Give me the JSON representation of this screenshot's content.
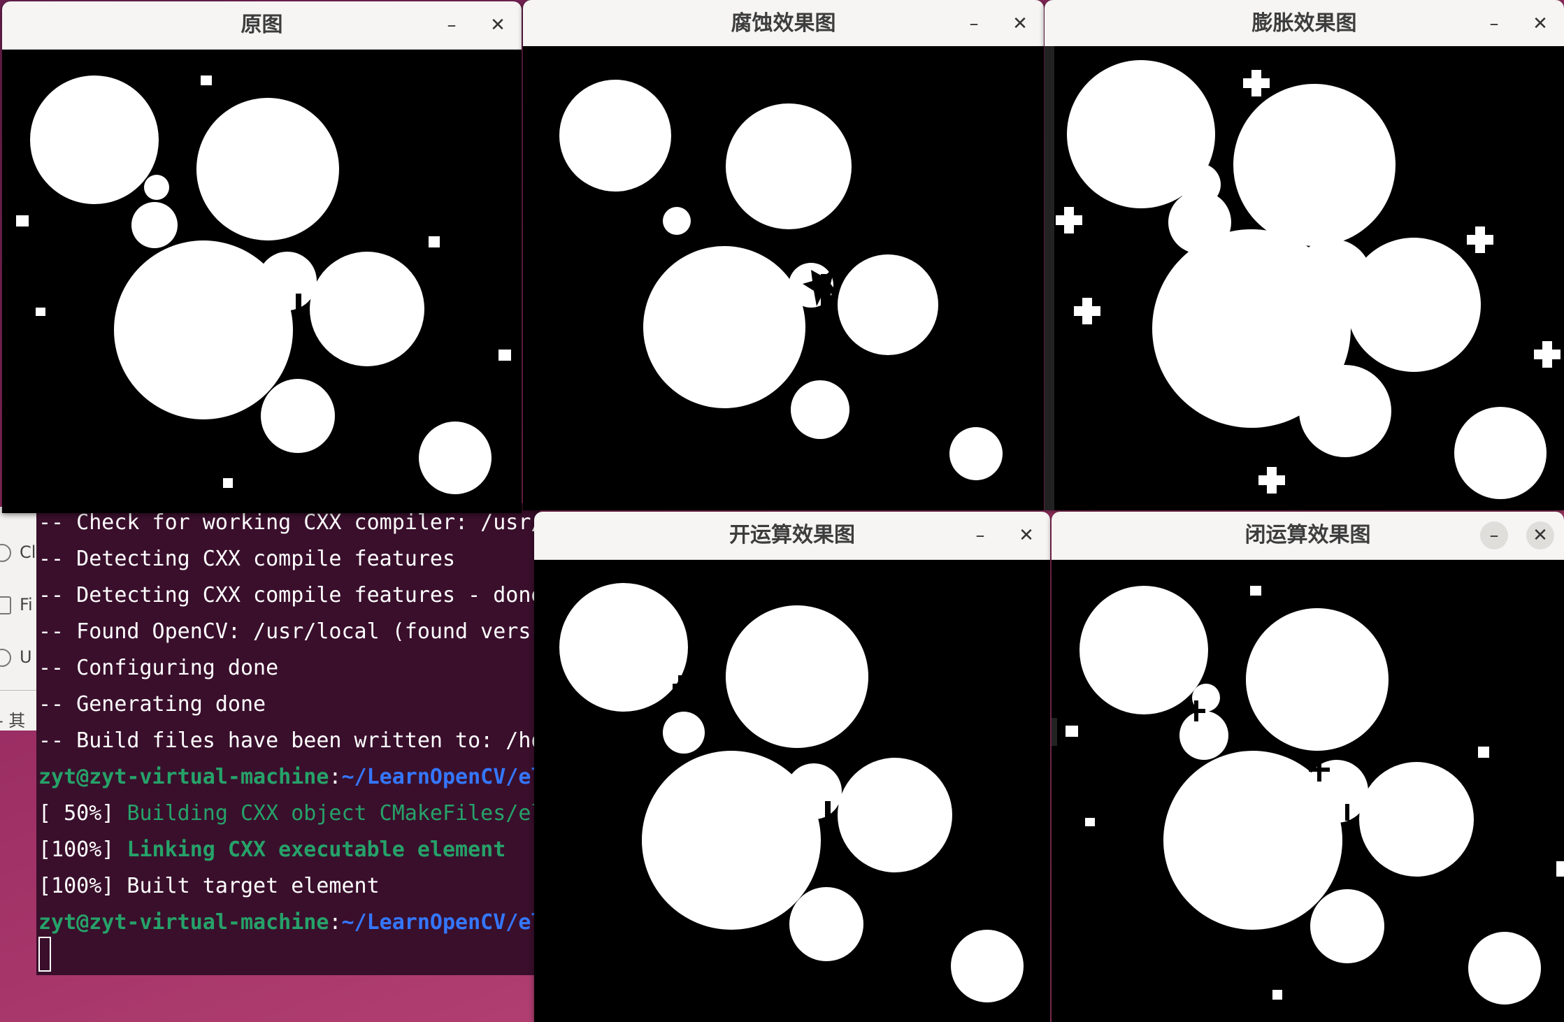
{
  "desktop": {
    "sidebar_entries": [
      {
        "label": "Cl",
        "icon": "clock-icon"
      },
      {
        "label": "Fi",
        "icon": "file-icon"
      },
      {
        "label": "U",
        "icon": "user-icon"
      }
    ],
    "bottom_label": "- 其"
  },
  "terminal": {
    "lines": [
      {
        "text": "-- Check for working CXX compiler: /usr/"
      },
      {
        "text": "-- Detecting CXX compile features"
      },
      {
        "text": "-- Detecting CXX compile features - done"
      },
      {
        "text": "-- Found OpenCV: /usr/local (found vers"
      },
      {
        "text": "-- Configuring done"
      },
      {
        "text": "-- Generating done"
      },
      {
        "text": "-- Build files have been written to: /ho"
      }
    ],
    "prompt1": {
      "user": "zyt@zyt-virtual-machine",
      "sep": ":",
      "path": "~/LearnOpenCV/el"
    },
    "build1": {
      "prefix": "[ 50%] ",
      "text": "Building CXX object CMakeFiles/el"
    },
    "build2": {
      "prefix": "[100%] ",
      "text": "Linking CXX executable element"
    },
    "build3": {
      "text": "[100%] Built target element"
    },
    "prompt2": {
      "user": "zyt@zyt-virtual-machine",
      "sep": ":",
      "path": "~/LearnOpenCV/el"
    }
  },
  "windows": [
    {
      "id": "original",
      "title": "原图",
      "minimize": "–",
      "close": "✕"
    },
    {
      "id": "erode",
      "title": "腐蚀效果图",
      "minimize": "–",
      "close": "✕"
    },
    {
      "id": "dilate",
      "title": "膨胀效果图",
      "minimize": "–",
      "close": "✕"
    },
    {
      "id": "open",
      "title": "开运算效果图",
      "minimize": "–",
      "close": "✕"
    },
    {
      "id": "close",
      "title": "闭运算效果图",
      "minimize": "–",
      "close": "✕"
    }
  ],
  "colors": {
    "terminal_bg": "#3a0f2c",
    "prompt_green": "#26a269",
    "prompt_blue": "#3477ff",
    "titlebar": "#f6f5f4"
  }
}
